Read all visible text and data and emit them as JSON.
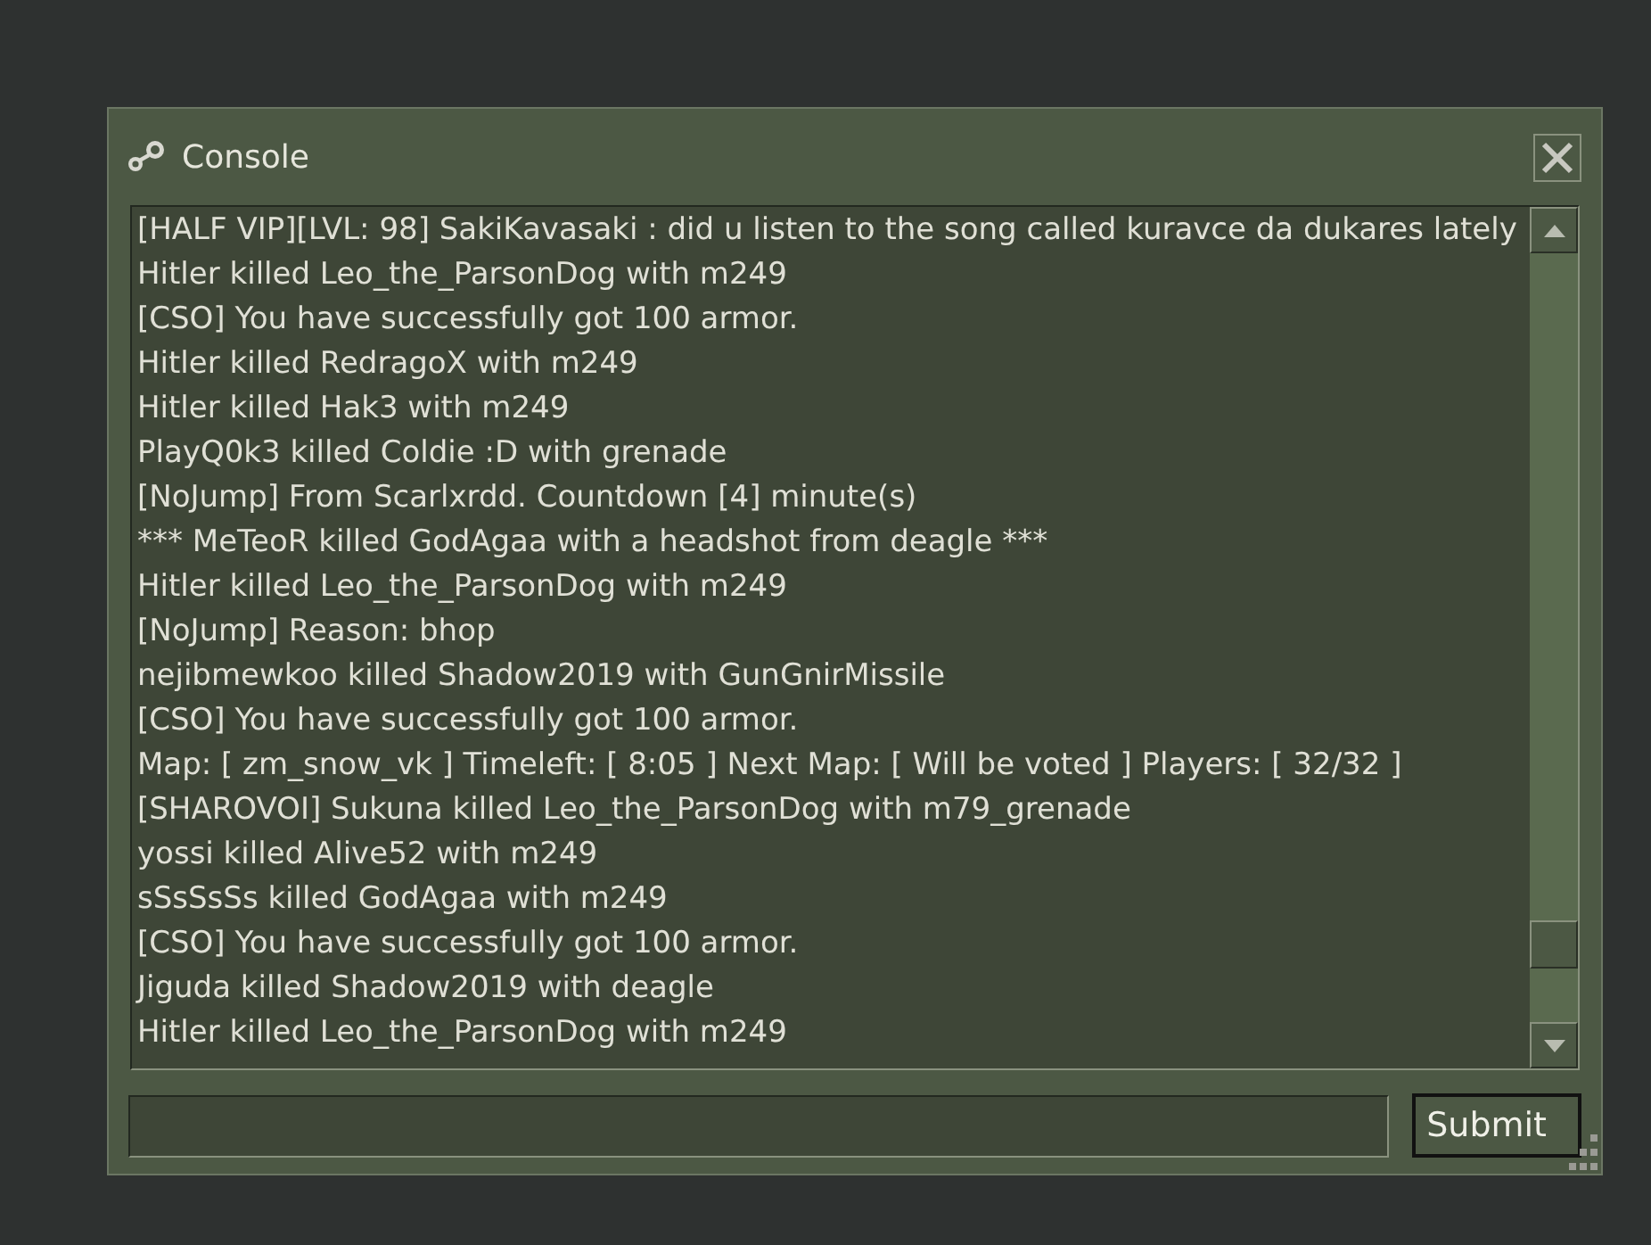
{
  "window": {
    "title": "Console"
  },
  "log": [
    "[HALF VIP][LVL: 98] SakiKavasaki : did u listen to the song called kuravce da dukares lately",
    "Hitler killed Leo_the_ParsonDog with m249",
    "[CSO] You have successfully got 100 armor.",
    "Hitler killed RedragoX with m249",
    "Hitler killed Hak3 with m249",
    "PlayQ0k3 killed Coldie :D with grenade",
    "[NoJump] From Scarlxrdd. Countdown [4] minute(s)",
    "*** MeTeoR killed GodAgaa with a headshot from deagle ***",
    "Hitler killed Leo_the_ParsonDog with m249",
    "[NoJump] Reason: bhop",
    "nejibmewkoo killed Shadow2019 with GunGnirMissile",
    "[CSO] You have successfully got 100 armor.",
    "Map: [ zm_snow_vk ] Timeleft: [ 8:05 ] Next Map: [ Will be voted ] Players: [ 32/32 ]",
    "[SHAROVOI] Sukuna killed Leo_the_ParsonDog with m79_grenade",
    "yossi killed Alive52 with m249",
    "sSsSsSs killed GodAgaa with m249",
    "[CSO] You have successfully got 100 armor.",
    "Jiguda killed Shadow2019 with deagle",
    "Hitler killed Leo_the_ParsonDog with m249"
  ],
  "submit": "Submit"
}
